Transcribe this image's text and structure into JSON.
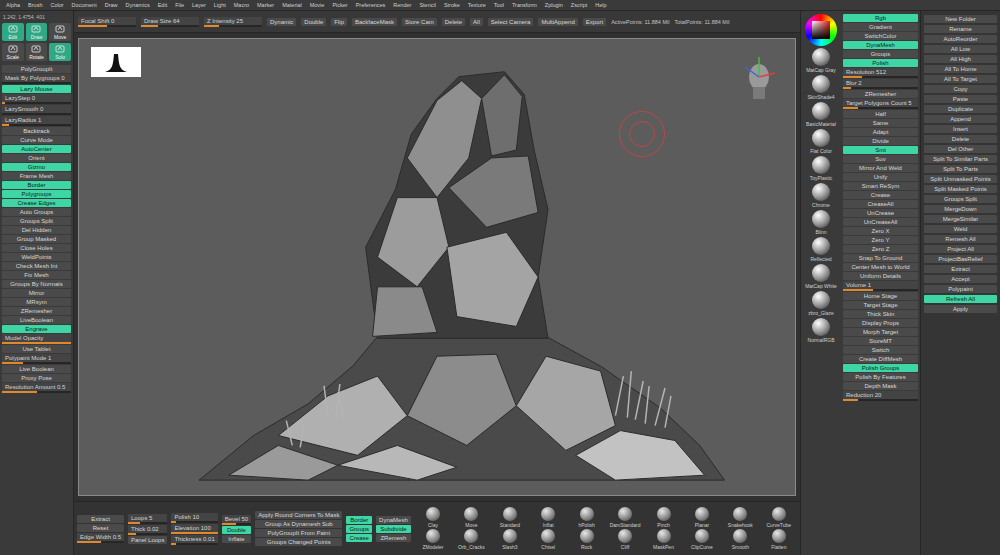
{
  "menu": [
    "Alpha",
    "Brush",
    "Color",
    "Document",
    "Draw",
    "Dynamics",
    "Edit",
    "File",
    "Layer",
    "Light",
    "Macro",
    "Marker",
    "Material",
    "Movie",
    "Picker",
    "Preferences",
    "Render",
    "Stencil",
    "Stroke",
    "Texture",
    "Tool",
    "Transform",
    "Zplugin",
    "Zscript",
    "Help"
  ],
  "toolbar": {
    "items": [
      {
        "label": "Focal Shift 0",
        "kind": "slider",
        "level": 0.5
      },
      {
        "label": "Draw Size 64",
        "kind": "slider",
        "level": 0.3
      },
      {
        "label": "Z Intensity 25",
        "kind": "slider",
        "level": 0.25
      },
      {
        "label": "Dynamic",
        "kind": "button",
        "on": false
      },
      {
        "label": "Double",
        "kind": "button",
        "on": false
      },
      {
        "label": "Flip",
        "kind": "button",
        "on": false
      },
      {
        "label": "BackfaceMask",
        "kind": "button",
        "on": false
      },
      {
        "label": "Store Cam",
        "kind": "button",
        "on": false
      },
      {
        "label": "Delete",
        "kind": "button",
        "on": false
      },
      {
        "label": "All",
        "kind": "button",
        "on": false
      },
      {
        "label": "Select Camera",
        "kind": "button",
        "on": false
      },
      {
        "label": "MultiAppend",
        "kind": "button",
        "on": false
      },
      {
        "label": "Export",
        "kind": "button",
        "on": false
      },
      {
        "label": "ActivePoints: 11.884 Mil",
        "kind": "stat"
      },
      {
        "label": "TotalPoints: 11.884 Mil",
        "kind": "stat"
      }
    ]
  },
  "left_panel": {
    "coords": "1.242, 1.4754, 401",
    "tools": [
      {
        "label": "Edit",
        "selected": true
      },
      {
        "label": "Draw",
        "selected": true
      },
      {
        "label": "Move",
        "selected": false
      },
      {
        "label": "Scale",
        "selected": false
      },
      {
        "label": "Rotate",
        "selected": false
      },
      {
        "label": "Solo",
        "selected": true
      }
    ],
    "items": [
      {
        "label": "PolyGroupIt",
        "kind": "button",
        "on": false
      },
      {
        "label": "Mask By Polygroups 0",
        "kind": "slider",
        "level": 0
      },
      {
        "label": "Lazy Mouse",
        "kind": "button",
        "on": true
      },
      {
        "label": "LazyStep 0",
        "kind": "slider",
        "level": 0.05
      },
      {
        "label": "LazySmooth 0",
        "kind": "slider",
        "level": 0
      },
      {
        "label": "LazyRadius 1",
        "kind": "slider",
        "level": 0.1
      },
      {
        "label": "Backtrack",
        "kind": "button",
        "on": false
      },
      {
        "label": "Curve Mode",
        "kind": "button",
        "on": false
      },
      {
        "label": "AutoCenter",
        "kind": "button",
        "on": true
      },
      {
        "label": "Orient",
        "kind": "button",
        "on": false
      },
      {
        "label": "Gizmo",
        "kind": "button",
        "on": true
      },
      {
        "label": "Frame Mesh",
        "kind": "button",
        "on": false
      },
      {
        "label": "Border",
        "kind": "button",
        "on": true
      },
      {
        "label": "Polygroups",
        "kind": "button",
        "on": true
      },
      {
        "label": "Crease Edges",
        "kind": "button",
        "on": true
      },
      {
        "label": "Auto Groups",
        "kind": "button",
        "on": false
      },
      {
        "label": "Groups Split",
        "kind": "button",
        "on": false
      },
      {
        "label": "Del Hidden",
        "kind": "button",
        "on": false
      },
      {
        "label": "Group Masked",
        "kind": "button",
        "on": false
      },
      {
        "label": "Close Holes",
        "kind": "button",
        "on": false
      },
      {
        "label": "WeldPoints",
        "kind": "button",
        "on": false
      },
      {
        "label": "Check Mesh Int",
        "kind": "button",
        "on": false
      },
      {
        "label": "Fix Mesh",
        "kind": "button",
        "on": false
      },
      {
        "label": "Groups By Normals",
        "kind": "button",
        "on": false
      },
      {
        "label": "Mirror",
        "kind": "button",
        "on": false
      },
      {
        "label": "MRsym",
        "kind": "button",
        "on": false
      },
      {
        "label": "ZRemesher",
        "kind": "button",
        "on": false
      },
      {
        "label": "LiveBoolean",
        "kind": "button",
        "on": false
      },
      {
        "label": "Engrave",
        "kind": "button",
        "on": true
      },
      {
        "label": "Model Opacity",
        "kind": "slider",
        "level": 1
      },
      {
        "label": "Use Tablet",
        "kind": "button",
        "on": false
      },
      {
        "label": "Polypaint Mode 1",
        "kind": "slider",
        "level": 0.3
      },
      {
        "label": "Live Boolean",
        "kind": "button",
        "on": false
      },
      {
        "label": "Proxy Pose",
        "kind": "button",
        "on": false
      },
      {
        "label": "Resolution Amount 0.5",
        "kind": "slider",
        "level": 0.5
      }
    ]
  },
  "right_tools": {
    "materials": [
      "MatCap Gray",
      "SkinShade4",
      "BasicMaterial",
      "Flat Color",
      "ToyPlastic",
      "Chrome",
      "Blinn",
      "Reflected",
      "MatCap White",
      "zbro_Glaze",
      "NormalRGB"
    ],
    "items": [
      {
        "label": "Rgb",
        "kind": "button",
        "on": true
      },
      {
        "label": "Gradient",
        "kind": "button",
        "on": false
      },
      {
        "label": "SwitchColor",
        "kind": "button",
        "on": false
      },
      {
        "label": "DynaMesh",
        "kind": "button",
        "on": true
      },
      {
        "label": "Groups",
        "kind": "button",
        "on": false
      },
      {
        "label": "Polish",
        "kind": "button",
        "on": true
      },
      {
        "label": "Resolution 512",
        "kind": "slider",
        "level": 0.25
      },
      {
        "label": "Blur 2",
        "kind": "slider",
        "level": 0.1
      },
      {
        "label": "ZRemesher",
        "kind": "button",
        "on": false
      },
      {
        "label": "Target Polygons Count 5",
        "kind": "slider",
        "level": 0.2
      },
      {
        "label": "Half",
        "kind": "button",
        "on": false
      },
      {
        "label": "Same",
        "kind": "button",
        "on": false
      },
      {
        "label": "Adapt",
        "kind": "button",
        "on": false
      },
      {
        "label": "Divide",
        "kind": "button",
        "on": false
      },
      {
        "label": "Smt",
        "kind": "button",
        "on": true
      },
      {
        "label": "Suv",
        "kind": "button",
        "on": false
      },
      {
        "label": "Mirror And Weld",
        "kind": "button",
        "on": false
      },
      {
        "label": "Unify",
        "kind": "button",
        "on": false
      },
      {
        "label": "Smart ReSym",
        "kind": "button",
        "on": false
      },
      {
        "label": "Crease",
        "kind": "button",
        "on": false
      },
      {
        "label": "CreaseAll",
        "kind": "button",
        "on": false
      },
      {
        "label": "UnCrease",
        "kind": "button",
        "on": false
      },
      {
        "label": "UnCreaseAll",
        "kind": "button",
        "on": false
      },
      {
        "label": "Zero X",
        "kind": "button",
        "on": false
      },
      {
        "label": "Zero Y",
        "kind": "button",
        "on": false
      },
      {
        "label": "Zero Z",
        "kind": "button",
        "on": false
      },
      {
        "label": "Snap To Ground",
        "kind": "button",
        "on": false
      },
      {
        "label": "Center Mesh to World",
        "kind": "button",
        "on": false
      },
      {
        "label": "Uniform Details",
        "kind": "button",
        "on": false
      },
      {
        "label": "Volume 1",
        "kind": "slider",
        "level": 0.4
      },
      {
        "label": "Home Stage",
        "kind": "button",
        "on": false
      },
      {
        "label": "Target Stage",
        "kind": "button",
        "on": false
      },
      {
        "label": "Thick Skin",
        "kind": "button",
        "on": false
      },
      {
        "label": "Display Props",
        "kind": "button",
        "on": false
      },
      {
        "label": "Morph Target",
        "kind": "button",
        "on": false
      },
      {
        "label": "StoreMT",
        "kind": "button",
        "on": false
      },
      {
        "label": "Switch",
        "kind": "button",
        "on": false
      },
      {
        "label": "Create DiffMesh",
        "kind": "button",
        "on": false
      },
      {
        "label": "Polish Groups",
        "kind": "button",
        "on": true
      },
      {
        "label": "Polish By Features",
        "kind": "button",
        "on": false
      },
      {
        "label": "Depth Mask",
        "kind": "button",
        "on": false
      },
      {
        "label": "Reduction 20",
        "kind": "slider",
        "level": 0.2
      }
    ]
  },
  "right_panel": {
    "items": [
      {
        "label": "New Folder",
        "on": false
      },
      {
        "label": "Rename",
        "on": false
      },
      {
        "label": "AutoReorder",
        "on": false
      },
      {
        "label": "All Low",
        "on": false
      },
      {
        "label": "All High",
        "on": false
      },
      {
        "label": "All To Home",
        "on": false
      },
      {
        "label": "All To Target",
        "on": false
      },
      {
        "label": "Copy",
        "on": false
      },
      {
        "label": "Paste",
        "on": false
      },
      {
        "label": "Duplicate",
        "on": false
      },
      {
        "label": "Append",
        "on": false
      },
      {
        "label": "Insert",
        "on": false
      },
      {
        "label": "Delete",
        "on": false
      },
      {
        "label": "Del Other",
        "on": false
      },
      {
        "label": "Split To Similar Parts",
        "on": false
      },
      {
        "label": "Split To Parts",
        "on": false
      },
      {
        "label": "Split Unmasked Points",
        "on": false
      },
      {
        "label": "Split Masked Points",
        "on": false
      },
      {
        "label": "Groups Split",
        "on": false
      },
      {
        "label": "MergeDown",
        "on": false
      },
      {
        "label": "MergeSimilar",
        "on": false
      },
      {
        "label": "Weld",
        "on": false
      },
      {
        "label": "Remesh All",
        "on": false
      },
      {
        "label": "Project All",
        "on": false
      },
      {
        "label": "ProjectBasRelief",
        "on": false
      },
      {
        "label": "Extract",
        "on": false
      },
      {
        "label": "Accept",
        "on": false
      },
      {
        "label": "Polypaint",
        "on": false
      },
      {
        "label": "Refresh All",
        "on": true
      },
      {
        "label": "Apply",
        "on": false
      }
    ]
  },
  "bottom": {
    "groups": [
      [
        {
          "label": "Extract",
          "kind": "button",
          "on": false
        },
        {
          "label": "Reset",
          "kind": "button",
          "on": false
        },
        {
          "label": "Edge Width 0.5",
          "kind": "slider",
          "level": 0.5
        }
      ],
      [
        {
          "label": "Loops 5",
          "kind": "slider",
          "level": 0.3
        },
        {
          "label": "Thick 0.02",
          "kind": "slider",
          "level": 0.2
        },
        {
          "label": "Panel Loops",
          "kind": "button",
          "on": false
        }
      ],
      [
        {
          "label": "Polish 10",
          "kind": "slider",
          "level": 0.1
        },
        {
          "label": "Elevation 100",
          "kind": "slider",
          "level": 1
        },
        {
          "label": "Thickness 0.01",
          "kind": "slider",
          "level": 0.1
        }
      ],
      [
        {
          "label": "Bevel 50",
          "kind": "slider",
          "level": 0.5
        },
        {
          "label": "Double",
          "kind": "button",
          "on": true
        },
        {
          "label": "Inflate",
          "kind": "button",
          "on": false
        }
      ],
      [
        {
          "label": "Apply Round Corners To Mask",
          "kind": "button",
          "on": false
        },
        {
          "label": "Group As Dynamesh Sub",
          "kind": "button",
          "on": false
        },
        {
          "label": "PolyGroupIt From Paint",
          "kind": "button",
          "on": false
        },
        {
          "label": "Groups Changed Points",
          "kind": "button",
          "on": false
        }
      ],
      [
        {
          "label": "Border",
          "kind": "button",
          "on": true
        },
        {
          "label": "Groups",
          "kind": "button",
          "on": true
        },
        {
          "label": "Crease",
          "kind": "button",
          "on": true
        }
      ],
      [
        {
          "label": "DynaMesh",
          "kind": "button",
          "on": false
        },
        {
          "label": "Subdivide",
          "kind": "button",
          "on": true
        },
        {
          "label": "ZRemesh",
          "kind": "button",
          "on": false
        }
      ]
    ],
    "brushes": [
      "Clay",
      "Move",
      "Standard",
      "Inflat",
      "hPolish",
      "DamStandard",
      "Pinch",
      "Planar",
      "Snakehook",
      "CurveTube",
      "ZModeler",
      "Orb_Cracks",
      "Slash3",
      "Chisel",
      "Rock",
      "Cliff",
      "MaskPen",
      "ClipCurve",
      "Smooth",
      "Flatten"
    ]
  }
}
